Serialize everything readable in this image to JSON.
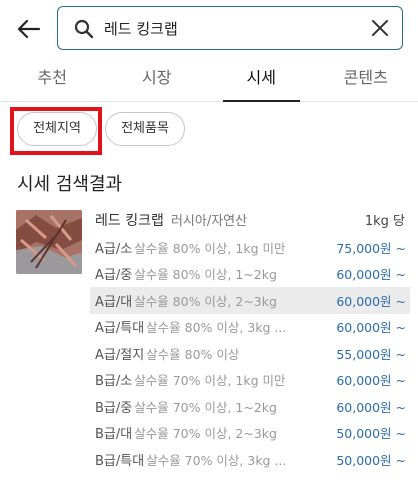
{
  "search": {
    "query": "레드 킹크랩"
  },
  "tabs": [
    {
      "label": "추천",
      "active": false
    },
    {
      "label": "시장",
      "active": false
    },
    {
      "label": "시세",
      "active": true
    },
    {
      "label": "콘텐츠",
      "active": false
    }
  ],
  "filters": {
    "region": "전체지역",
    "item": "전체품목"
  },
  "section_title": "시세 검색결과",
  "product": {
    "name": "레드 킹크랩",
    "origin": "러시아/자연산",
    "unit": "1kg 당"
  },
  "price_rows": [
    {
      "grade": "A급/소",
      "desc": "살수율 80% 이상, 1kg 미만",
      "price": "75,000원 ~"
    },
    {
      "grade": "A급/중",
      "desc": "살수율 80% 이상, 1~2kg",
      "price": "60,000원 ~"
    },
    {
      "grade": "A급/대",
      "desc": "살수율 80% 이상, 2~3kg",
      "price": "60,000원 ~"
    },
    {
      "grade": "A급/특대",
      "desc": "살수율 80% 이상, 3kg ...",
      "price": "60,000원 ~"
    },
    {
      "grade": "A급/절지",
      "desc": "살수율 80% 이상",
      "price": "55,000원 ~"
    },
    {
      "grade": "B급/소",
      "desc": "살수율 70% 이상, 1kg 미만",
      "price": "60,000원 ~"
    },
    {
      "grade": "B급/중",
      "desc": "살수율 70% 이상, 1~2kg",
      "price": "60,000원 ~"
    },
    {
      "grade": "B급/대",
      "desc": "살수율 70% 이상, 2~3kg",
      "price": "50,000원 ~"
    },
    {
      "grade": "B급/특대",
      "desc": "살수율 70% 이상, 3kg ...",
      "price": "50,000원 ~"
    }
  ],
  "icons": {
    "back": "arrow-left-icon",
    "search": "search-icon",
    "clear": "close-icon"
  },
  "colors": {
    "accent": "#2b6e7e",
    "price": "#2b6cb0",
    "highlight": "#e0131b"
  }
}
